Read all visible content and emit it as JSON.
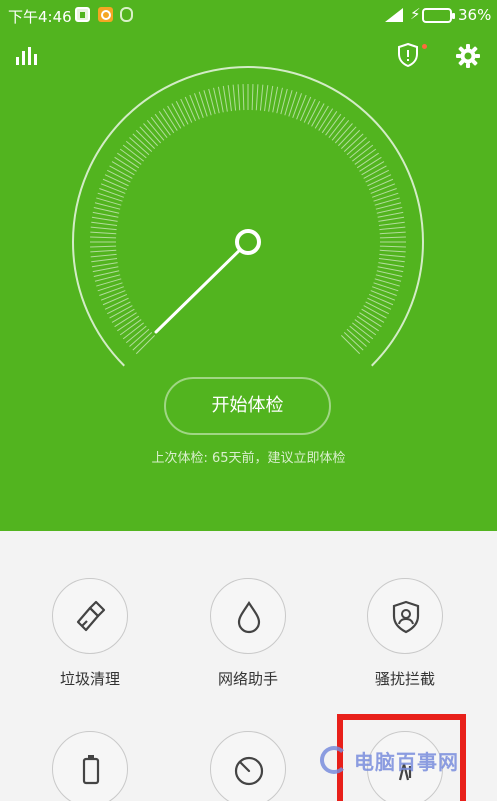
{
  "status_bar": {
    "time": "下午4:46",
    "battery_percent": "36%",
    "icons": [
      "sim-icon",
      "app-notification-icon",
      "robot-icon",
      "signal-icon",
      "charging-icon",
      "battery-icon"
    ]
  },
  "header": {
    "left_icon": "stats-icon",
    "right_icons": [
      "shield-icon",
      "gear-icon"
    ],
    "shield_badge_color": "#ff6a3d"
  },
  "theme": {
    "primary_green": "#52b41f",
    "highlight_red": "#e8201a"
  },
  "checkup": {
    "button_label": "开始体检",
    "last_check_text": "上次体检: 65天前，建议立即体检"
  },
  "tools": [
    {
      "label": "垃圾清理",
      "icon": "broom-icon"
    },
    {
      "label": "网络助手",
      "icon": "droplet-icon"
    },
    {
      "label": "骚扰拦截",
      "icon": "user-shield-icon"
    },
    {
      "label": "",
      "icon": "battery-icon"
    },
    {
      "label": "",
      "icon": "stopwatch-icon"
    },
    {
      "label": "",
      "icon": "app-icon"
    }
  ],
  "watermark": {
    "text": "电脑百事网"
  }
}
